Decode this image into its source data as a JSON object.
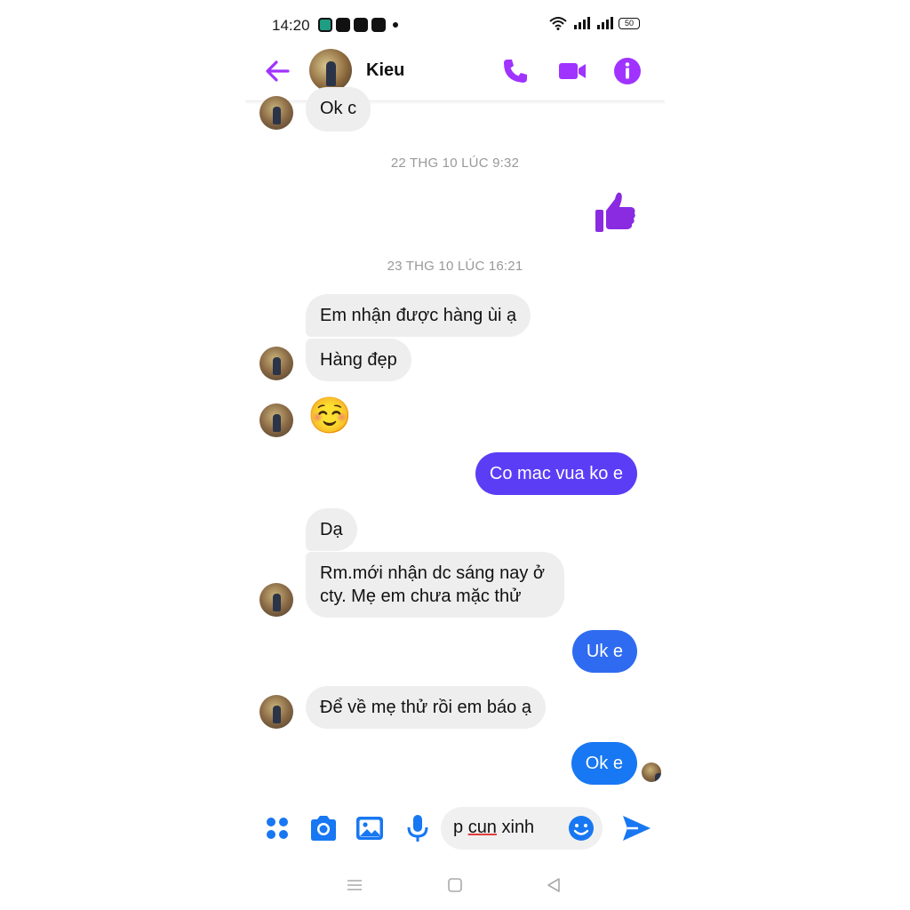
{
  "status_bar": {
    "time": "14:20",
    "battery": "50"
  },
  "header": {
    "contact_name": "Kieu",
    "icons": [
      "back-arrow-icon",
      "phone-icon",
      "video-camera-icon",
      "info-icon"
    ]
  },
  "colors": {
    "accent_purple": "#a033ff",
    "bubble_incoming": "#eeeeee",
    "bubble_violet": "#5b3df5",
    "bubble_blue": "#2f6bf0",
    "bubble_blue_light": "#1877f2",
    "composer_blue": "#1877f2"
  },
  "messages": {
    "m0": "Ok c",
    "ts1": "22 THG 10 LÚC 9:32",
    "ts2": "23 THG 10 LÚC 16:21",
    "m1": "Em nhận được hàng ùi ạ",
    "m2": "Hàng đẹp",
    "m3": "☺️",
    "m4": "Co mac vua ko e",
    "m5": "Dạ",
    "m6": "Rm.mới nhận dc sáng nay ở cty. Mẹ em chưa mặc thử",
    "m7": "Uk e",
    "m8": "Để về mẹ thử rồi em báo ạ",
    "m9": "Ok e"
  },
  "composer": {
    "text_prefix": "p ",
    "text_underlined": "cun",
    "text_suffix": " xinh",
    "icons": [
      "apps-icon",
      "camera-icon",
      "image-icon",
      "microphone-icon",
      "emoji-icon",
      "send-icon"
    ]
  }
}
